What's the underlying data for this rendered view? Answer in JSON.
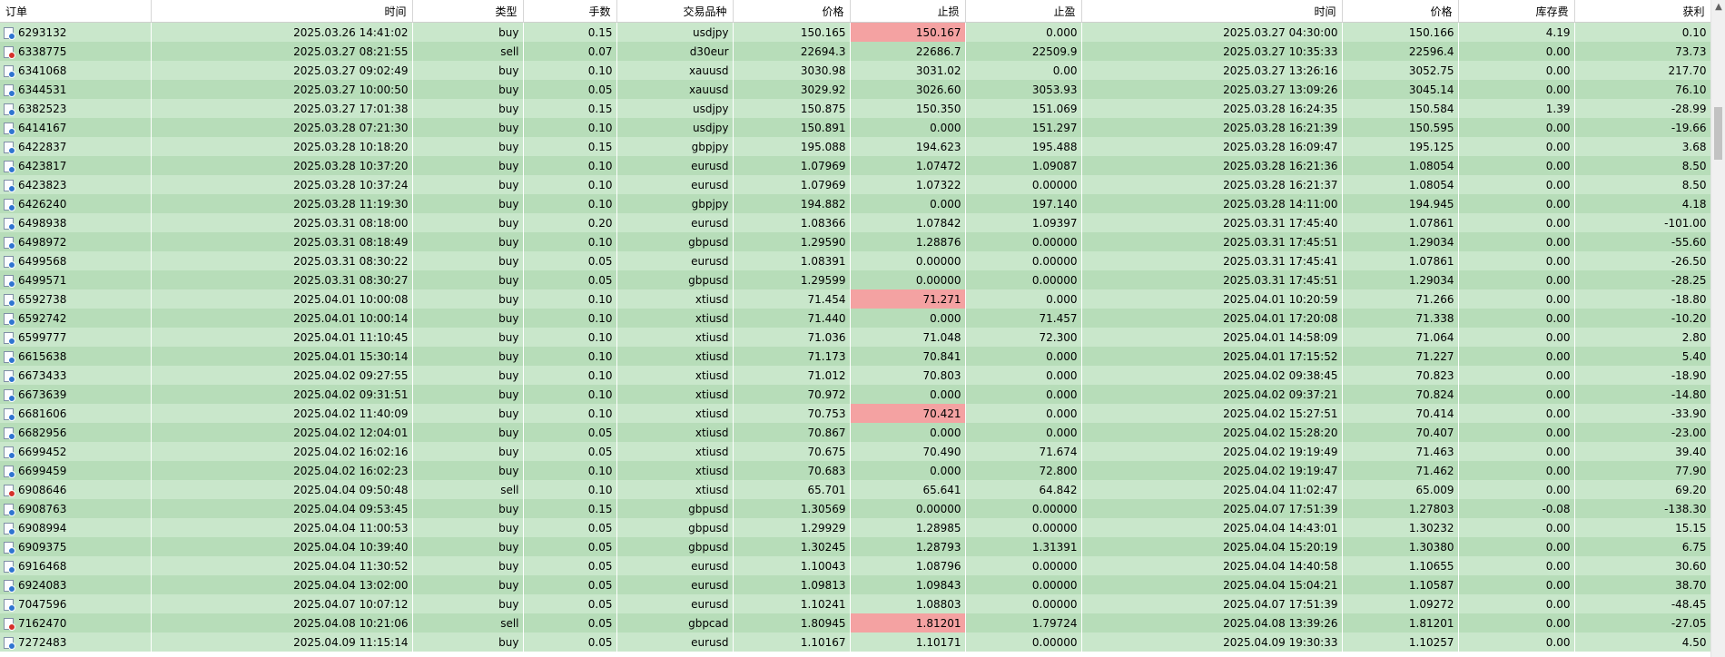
{
  "columns": [
    "订单",
    "时间",
    "类型",
    "手数",
    "交易品种",
    "价格",
    "止损",
    "止盈",
    "时间",
    "价格",
    "库存费",
    "获利"
  ],
  "sort_indicator": "/",
  "icons": {
    "buy": "order-buy-icon",
    "sell": "order-sell-icon",
    "scroll_up": "chevron-up-icon"
  },
  "colors": {
    "row_a": "#c9e7cb",
    "row_b": "#b7ddb9",
    "sl_highlight": "#f4a2a2"
  },
  "rows": [
    {
      "order": "6293132",
      "open_time": "2025.03.26 14:41:02",
      "type": "buy",
      "volume": "0.15",
      "symbol": "usdjpy",
      "open_price": "150.165",
      "sl": "150.167",
      "tp": "0.000",
      "close_time": "2025.03.27 04:30:00",
      "close_price": "150.166",
      "swap": "4.19",
      "profit": "0.10",
      "sl_hit": true
    },
    {
      "order": "6338775",
      "open_time": "2025.03.27 08:21:55",
      "type": "sell",
      "volume": "0.07",
      "symbol": "d30eur",
      "open_price": "22694.3",
      "sl": "22686.7",
      "tp": "22509.9",
      "close_time": "2025.03.27 10:35:33",
      "close_price": "22596.4",
      "swap": "0.00",
      "profit": "73.73",
      "sl_hit": false
    },
    {
      "order": "6341068",
      "open_time": "2025.03.27 09:02:49",
      "type": "buy",
      "volume": "0.10",
      "symbol": "xauusd",
      "open_price": "3030.98",
      "sl": "3031.02",
      "tp": "0.00",
      "close_time": "2025.03.27 13:26:16",
      "close_price": "3052.75",
      "swap": "0.00",
      "profit": "217.70",
      "sl_hit": false
    },
    {
      "order": "6344531",
      "open_time": "2025.03.27 10:00:50",
      "type": "buy",
      "volume": "0.05",
      "symbol": "xauusd",
      "open_price": "3029.92",
      "sl": "3026.60",
      "tp": "3053.93",
      "close_time": "2025.03.27 13:09:26",
      "close_price": "3045.14",
      "swap": "0.00",
      "profit": "76.10",
      "sl_hit": false
    },
    {
      "order": "6382523",
      "open_time": "2025.03.27 17:01:38",
      "type": "buy",
      "volume": "0.15",
      "symbol": "usdjpy",
      "open_price": "150.875",
      "sl": "150.350",
      "tp": "151.069",
      "close_time": "2025.03.28 16:24:35",
      "close_price": "150.584",
      "swap": "1.39",
      "profit": "-28.99",
      "sl_hit": false
    },
    {
      "order": "6414167",
      "open_time": "2025.03.28 07:21:30",
      "type": "buy",
      "volume": "0.10",
      "symbol": "usdjpy",
      "open_price": "150.891",
      "sl": "0.000",
      "tp": "151.297",
      "close_time": "2025.03.28 16:21:39",
      "close_price": "150.595",
      "swap": "0.00",
      "profit": "-19.66",
      "sl_hit": false
    },
    {
      "order": "6422837",
      "open_time": "2025.03.28 10:18:20",
      "type": "buy",
      "volume": "0.15",
      "symbol": "gbpjpy",
      "open_price": "195.088",
      "sl": "194.623",
      "tp": "195.488",
      "close_time": "2025.03.28 16:09:47",
      "close_price": "195.125",
      "swap": "0.00",
      "profit": "3.68",
      "sl_hit": false
    },
    {
      "order": "6423817",
      "open_time": "2025.03.28 10:37:20",
      "type": "buy",
      "volume": "0.10",
      "symbol": "eurusd",
      "open_price": "1.07969",
      "sl": "1.07472",
      "tp": "1.09087",
      "close_time": "2025.03.28 16:21:36",
      "close_price": "1.08054",
      "swap": "0.00",
      "profit": "8.50",
      "sl_hit": false
    },
    {
      "order": "6423823",
      "open_time": "2025.03.28 10:37:24",
      "type": "buy",
      "volume": "0.10",
      "symbol": "eurusd",
      "open_price": "1.07969",
      "sl": "1.07322",
      "tp": "0.00000",
      "close_time": "2025.03.28 16:21:37",
      "close_price": "1.08054",
      "swap": "0.00",
      "profit": "8.50",
      "sl_hit": false
    },
    {
      "order": "6426240",
      "open_time": "2025.03.28 11:19:30",
      "type": "buy",
      "volume": "0.10",
      "symbol": "gbpjpy",
      "open_price": "194.882",
      "sl": "0.000",
      "tp": "197.140",
      "close_time": "2025.03.28 14:11:00",
      "close_price": "194.945",
      "swap": "0.00",
      "profit": "4.18",
      "sl_hit": false
    },
    {
      "order": "6498938",
      "open_time": "2025.03.31 08:18:00",
      "type": "buy",
      "volume": "0.20",
      "symbol": "eurusd",
      "open_price": "1.08366",
      "sl": "1.07842",
      "tp": "1.09397",
      "close_time": "2025.03.31 17:45:40",
      "close_price": "1.07861",
      "swap": "0.00",
      "profit": "-101.00",
      "sl_hit": false
    },
    {
      "order": "6498972",
      "open_time": "2025.03.31 08:18:49",
      "type": "buy",
      "volume": "0.10",
      "symbol": "gbpusd",
      "open_price": "1.29590",
      "sl": "1.28876",
      "tp": "0.00000",
      "close_time": "2025.03.31 17:45:51",
      "close_price": "1.29034",
      "swap": "0.00",
      "profit": "-55.60",
      "sl_hit": false
    },
    {
      "order": "6499568",
      "open_time": "2025.03.31 08:30:22",
      "type": "buy",
      "volume": "0.05",
      "symbol": "eurusd",
      "open_price": "1.08391",
      "sl": "0.00000",
      "tp": "0.00000",
      "close_time": "2025.03.31 17:45:41",
      "close_price": "1.07861",
      "swap": "0.00",
      "profit": "-26.50",
      "sl_hit": false
    },
    {
      "order": "6499571",
      "open_time": "2025.03.31 08:30:27",
      "type": "buy",
      "volume": "0.05",
      "symbol": "gbpusd",
      "open_price": "1.29599",
      "sl": "0.00000",
      "tp": "0.00000",
      "close_time": "2025.03.31 17:45:51",
      "close_price": "1.29034",
      "swap": "0.00",
      "profit": "-28.25",
      "sl_hit": false
    },
    {
      "order": "6592738",
      "open_time": "2025.04.01 10:00:08",
      "type": "buy",
      "volume": "0.10",
      "symbol": "xtiusd",
      "open_price": "71.454",
      "sl": "71.271",
      "tp": "0.000",
      "close_time": "2025.04.01 10:20:59",
      "close_price": "71.266",
      "swap": "0.00",
      "profit": "-18.80",
      "sl_hit": true
    },
    {
      "order": "6592742",
      "open_time": "2025.04.01 10:00:14",
      "type": "buy",
      "volume": "0.10",
      "symbol": "xtiusd",
      "open_price": "71.440",
      "sl": "0.000",
      "tp": "71.457",
      "close_time": "2025.04.01 17:20:08",
      "close_price": "71.338",
      "swap": "0.00",
      "profit": "-10.20",
      "sl_hit": false
    },
    {
      "order": "6599777",
      "open_time": "2025.04.01 11:10:45",
      "type": "buy",
      "volume": "0.10",
      "symbol": "xtiusd",
      "open_price": "71.036",
      "sl": "71.048",
      "tp": "72.300",
      "close_time": "2025.04.01 14:58:09",
      "close_price": "71.064",
      "swap": "0.00",
      "profit": "2.80",
      "sl_hit": false
    },
    {
      "order": "6615638",
      "open_time": "2025.04.01 15:30:14",
      "type": "buy",
      "volume": "0.10",
      "symbol": "xtiusd",
      "open_price": "71.173",
      "sl": "70.841",
      "tp": "0.000",
      "close_time": "2025.04.01 17:15:52",
      "close_price": "71.227",
      "swap": "0.00",
      "profit": "5.40",
      "sl_hit": false
    },
    {
      "order": "6673433",
      "open_time": "2025.04.02 09:27:55",
      "type": "buy",
      "volume": "0.10",
      "symbol": "xtiusd",
      "open_price": "71.012",
      "sl": "70.803",
      "tp": "0.000",
      "close_time": "2025.04.02 09:38:45",
      "close_price": "70.823",
      "swap": "0.00",
      "profit": "-18.90",
      "sl_hit": false
    },
    {
      "order": "6673639",
      "open_time": "2025.04.02 09:31:51",
      "type": "buy",
      "volume": "0.10",
      "symbol": "xtiusd",
      "open_price": "70.972",
      "sl": "0.000",
      "tp": "0.000",
      "close_time": "2025.04.02 09:37:21",
      "close_price": "70.824",
      "swap": "0.00",
      "profit": "-14.80",
      "sl_hit": false
    },
    {
      "order": "6681606",
      "open_time": "2025.04.02 11:40:09",
      "type": "buy",
      "volume": "0.10",
      "symbol": "xtiusd",
      "open_price": "70.753",
      "sl": "70.421",
      "tp": "0.000",
      "close_time": "2025.04.02 15:27:51",
      "close_price": "70.414",
      "swap": "0.00",
      "profit": "-33.90",
      "sl_hit": true
    },
    {
      "order": "6682956",
      "open_time": "2025.04.02 12:04:01",
      "type": "buy",
      "volume": "0.05",
      "symbol": "xtiusd",
      "open_price": "70.867",
      "sl": "0.000",
      "tp": "0.000",
      "close_time": "2025.04.02 15:28:20",
      "close_price": "70.407",
      "swap": "0.00",
      "profit": "-23.00",
      "sl_hit": false
    },
    {
      "order": "6699452",
      "open_time": "2025.04.02 16:02:16",
      "type": "buy",
      "volume": "0.05",
      "symbol": "xtiusd",
      "open_price": "70.675",
      "sl": "70.490",
      "tp": "71.674",
      "close_time": "2025.04.02 19:19:49",
      "close_price": "71.463",
      "swap": "0.00",
      "profit": "39.40",
      "sl_hit": false
    },
    {
      "order": "6699459",
      "open_time": "2025.04.02 16:02:23",
      "type": "buy",
      "volume": "0.10",
      "symbol": "xtiusd",
      "open_price": "70.683",
      "sl": "0.000",
      "tp": "72.800",
      "close_time": "2025.04.02 19:19:47",
      "close_price": "71.462",
      "swap": "0.00",
      "profit": "77.90",
      "sl_hit": false
    },
    {
      "order": "6908646",
      "open_time": "2025.04.04 09:50:48",
      "type": "sell",
      "volume": "0.10",
      "symbol": "xtiusd",
      "open_price": "65.701",
      "sl": "65.641",
      "tp": "64.842",
      "close_time": "2025.04.04 11:02:47",
      "close_price": "65.009",
      "swap": "0.00",
      "profit": "69.20",
      "sl_hit": false
    },
    {
      "order": "6908763",
      "open_time": "2025.04.04 09:53:45",
      "type": "buy",
      "volume": "0.15",
      "symbol": "gbpusd",
      "open_price": "1.30569",
      "sl": "0.00000",
      "tp": "0.00000",
      "close_time": "2025.04.07 17:51:39",
      "close_price": "1.27803",
      "swap": "-0.08",
      "profit": "-138.30",
      "sl_hit": false
    },
    {
      "order": "6908994",
      "open_time": "2025.04.04 11:00:53",
      "type": "buy",
      "volume": "0.05",
      "symbol": "gbpusd",
      "open_price": "1.29929",
      "sl": "1.28985",
      "tp": "0.00000",
      "close_time": "2025.04.04 14:43:01",
      "close_price": "1.30232",
      "swap": "0.00",
      "profit": "15.15",
      "sl_hit": false
    },
    {
      "order": "6909375",
      "open_time": "2025.04.04 10:39:40",
      "type": "buy",
      "volume": "0.05",
      "symbol": "gbpusd",
      "open_price": "1.30245",
      "sl": "1.28793",
      "tp": "1.31391",
      "close_time": "2025.04.04 15:20:19",
      "close_price": "1.30380",
      "swap": "0.00",
      "profit": "6.75",
      "sl_hit": false
    },
    {
      "order": "6916468",
      "open_time": "2025.04.04 11:30:52",
      "type": "buy",
      "volume": "0.05",
      "symbol": "eurusd",
      "open_price": "1.10043",
      "sl": "1.08796",
      "tp": "0.00000",
      "close_time": "2025.04.04 14:40:58",
      "close_price": "1.10655",
      "swap": "0.00",
      "profit": "30.60",
      "sl_hit": false
    },
    {
      "order": "6924083",
      "open_time": "2025.04.04 13:02:00",
      "type": "buy",
      "volume": "0.05",
      "symbol": "eurusd",
      "open_price": "1.09813",
      "sl": "1.09843",
      "tp": "0.00000",
      "close_time": "2025.04.04 15:04:21",
      "close_price": "1.10587",
      "swap": "0.00",
      "profit": "38.70",
      "sl_hit": false
    },
    {
      "order": "7047596",
      "open_time": "2025.04.07 10:07:12",
      "type": "buy",
      "volume": "0.05",
      "symbol": "eurusd",
      "open_price": "1.10241",
      "sl": "1.08803",
      "tp": "0.00000",
      "close_time": "2025.04.07 17:51:39",
      "close_price": "1.09272",
      "swap": "0.00",
      "profit": "-48.45",
      "sl_hit": false
    },
    {
      "order": "7162470",
      "open_time": "2025.04.08 10:21:06",
      "type": "sell",
      "volume": "0.05",
      "symbol": "gbpcad",
      "open_price": "1.80945",
      "sl": "1.81201",
      "tp": "1.79724",
      "close_time": "2025.04.08 13:39:26",
      "close_price": "1.81201",
      "swap": "0.00",
      "profit": "-27.05",
      "sl_hit": true
    },
    {
      "order": "7272483",
      "open_time": "2025.04.09 11:15:14",
      "type": "buy",
      "volume": "0.05",
      "symbol": "eurusd",
      "open_price": "1.10167",
      "sl": "1.10171",
      "tp": "0.00000",
      "close_time": "2025.04.09 19:30:33",
      "close_price": "1.10257",
      "swap": "0.00",
      "profit": "4.50",
      "sl_hit": false
    }
  ]
}
